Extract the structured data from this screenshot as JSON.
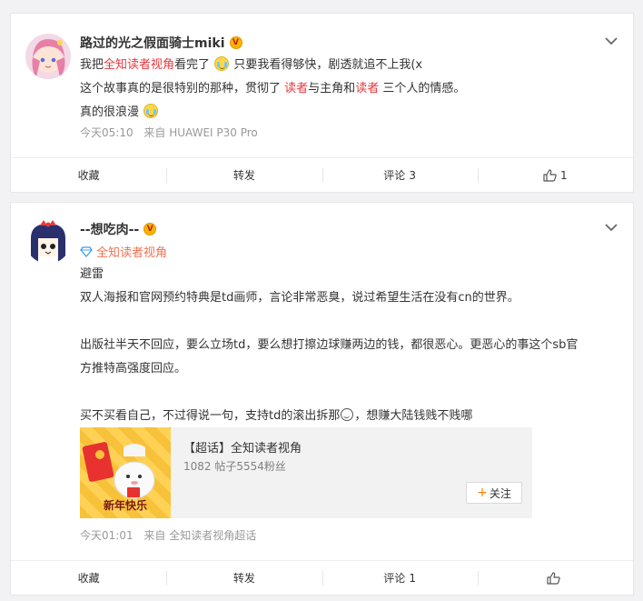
{
  "posts": [
    {
      "author": "路过的光之假面骑士miki",
      "vip_badge": "V",
      "content_lines": {
        "l1_a": "我把",
        "l1_hl": "全知读者视角",
        "l1_b": "看完了",
        "l1_c": "只要我看得够快，剧透就追不上我(x",
        "l2_a": "这个故事真的是很特别的那种，贯彻了",
        "l2_hl1": "读者",
        "l2_b": "与主角和",
        "l2_hl2": "读者",
        "l2_c": "三个人的情感。",
        "l3_a": "真的很浪漫"
      },
      "time": "今天05:10",
      "source": "来自 HUAWEI P30 Pro",
      "actions": {
        "favorite": "收藏",
        "repost": "转发",
        "comment": "评论",
        "comment_count": "3",
        "like_count": "1"
      },
      "colors": {
        "highlight": "#e6393d"
      }
    },
    {
      "author": "--想吃肉--",
      "vip_badge": "V",
      "super_topic": "全知读者视角",
      "content_lines": {
        "l1": "避雷",
        "l2": "双人海报和官网预约特典是td画师，言论非常恶臭，说过希望生活在没有cn的世界。",
        "l3": "出版社半天不回应，要么立场td，要么想打擦边球赚两边的钱，都很恶心。更恶心的事这个sb官",
        "l4": "方推特高强度回应。",
        "l5_a": "买不买看自己，不过得说一句，支持td的滚出拆那",
        "l5_b": "，想赚大陆钱贱不贱哪"
      },
      "link_card": {
        "title": "【超话】全知读者视角",
        "subtitle": "1082 帖子5554粉丝",
        "follow_label": "关注",
        "image_text": "新年快乐"
      },
      "time": "今天01:01",
      "source": "来自 全知读者视角超话",
      "actions": {
        "favorite": "收藏",
        "repost": "转发",
        "comment": "评论",
        "comment_count": "1",
        "like_count": ""
      },
      "colors": {
        "super_topic": "#eb7350"
      }
    }
  ]
}
